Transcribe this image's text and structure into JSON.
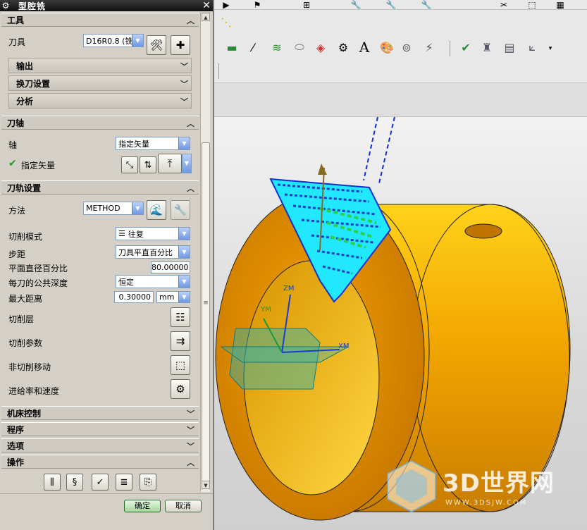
{
  "dialog": {
    "title": "型腔铣",
    "ok_label": "确定",
    "cancel_label": "取消"
  },
  "tool_section": {
    "header": "工具",
    "tool_label": "刀具",
    "tool_value": "D16R0.8 (铣",
    "subsections": [
      "输出",
      "换刀设置",
      "分析"
    ]
  },
  "axis_section": {
    "header": "刀轴",
    "axis_label": "轴",
    "axis_value": "指定矢量",
    "vector_label": "指定矢量"
  },
  "path_section": {
    "header": "刀轨设置",
    "method_label": "方法",
    "method_value": "METHOD",
    "cut_pattern_label": "切削模式",
    "cut_pattern_value": "往复",
    "stepover_label": "步距",
    "stepover_value": "刀具平直百分比",
    "percent_label": "平面直径百分比",
    "percent_value": "80.00000",
    "depth_label": "每刀的公共深度",
    "depth_value": "恒定",
    "max_dist_label": "最大距离",
    "max_dist_value": "0.30000",
    "max_dist_unit": "mm",
    "cut_levels_label": "切削层",
    "cut_params_label": "切削参数",
    "non_cut_label": "非切削移动",
    "feeds_label": "进给率和速度"
  },
  "collapsed_sections": [
    "机床控制",
    "程序",
    "选项"
  ],
  "ops_section": {
    "header": "操作"
  },
  "viewport": {
    "axis_labels": {
      "zm": "ZM",
      "ym": "YM",
      "xm": "XM"
    },
    "cylinder_color": "#f0a800",
    "watermark_main": "3D世界网",
    "watermark_url": "WWW.3DSJW.COM"
  },
  "icons": {
    "dialog": "gear-icon",
    "close": "close-icon",
    "edit_tool": "edit-tool-icon",
    "new_tool": "new-tool-icon",
    "vector_dialog": "vector-dialog-icon",
    "vector_flip": "vector-flip-icon",
    "vector_triad": "vector-triad-icon",
    "method_edit": "method-edit-icon",
    "method_wrench": "wrench-icon",
    "cut_levels": "cut-levels-icon",
    "cut_params": "cut-params-icon",
    "non_cut": "non-cut-moves-icon",
    "feeds": "feeds-speeds-icon",
    "ops": [
      "generate-icon",
      "replay-icon",
      "verify-icon",
      "list-icon",
      "analyze-icon"
    ]
  }
}
